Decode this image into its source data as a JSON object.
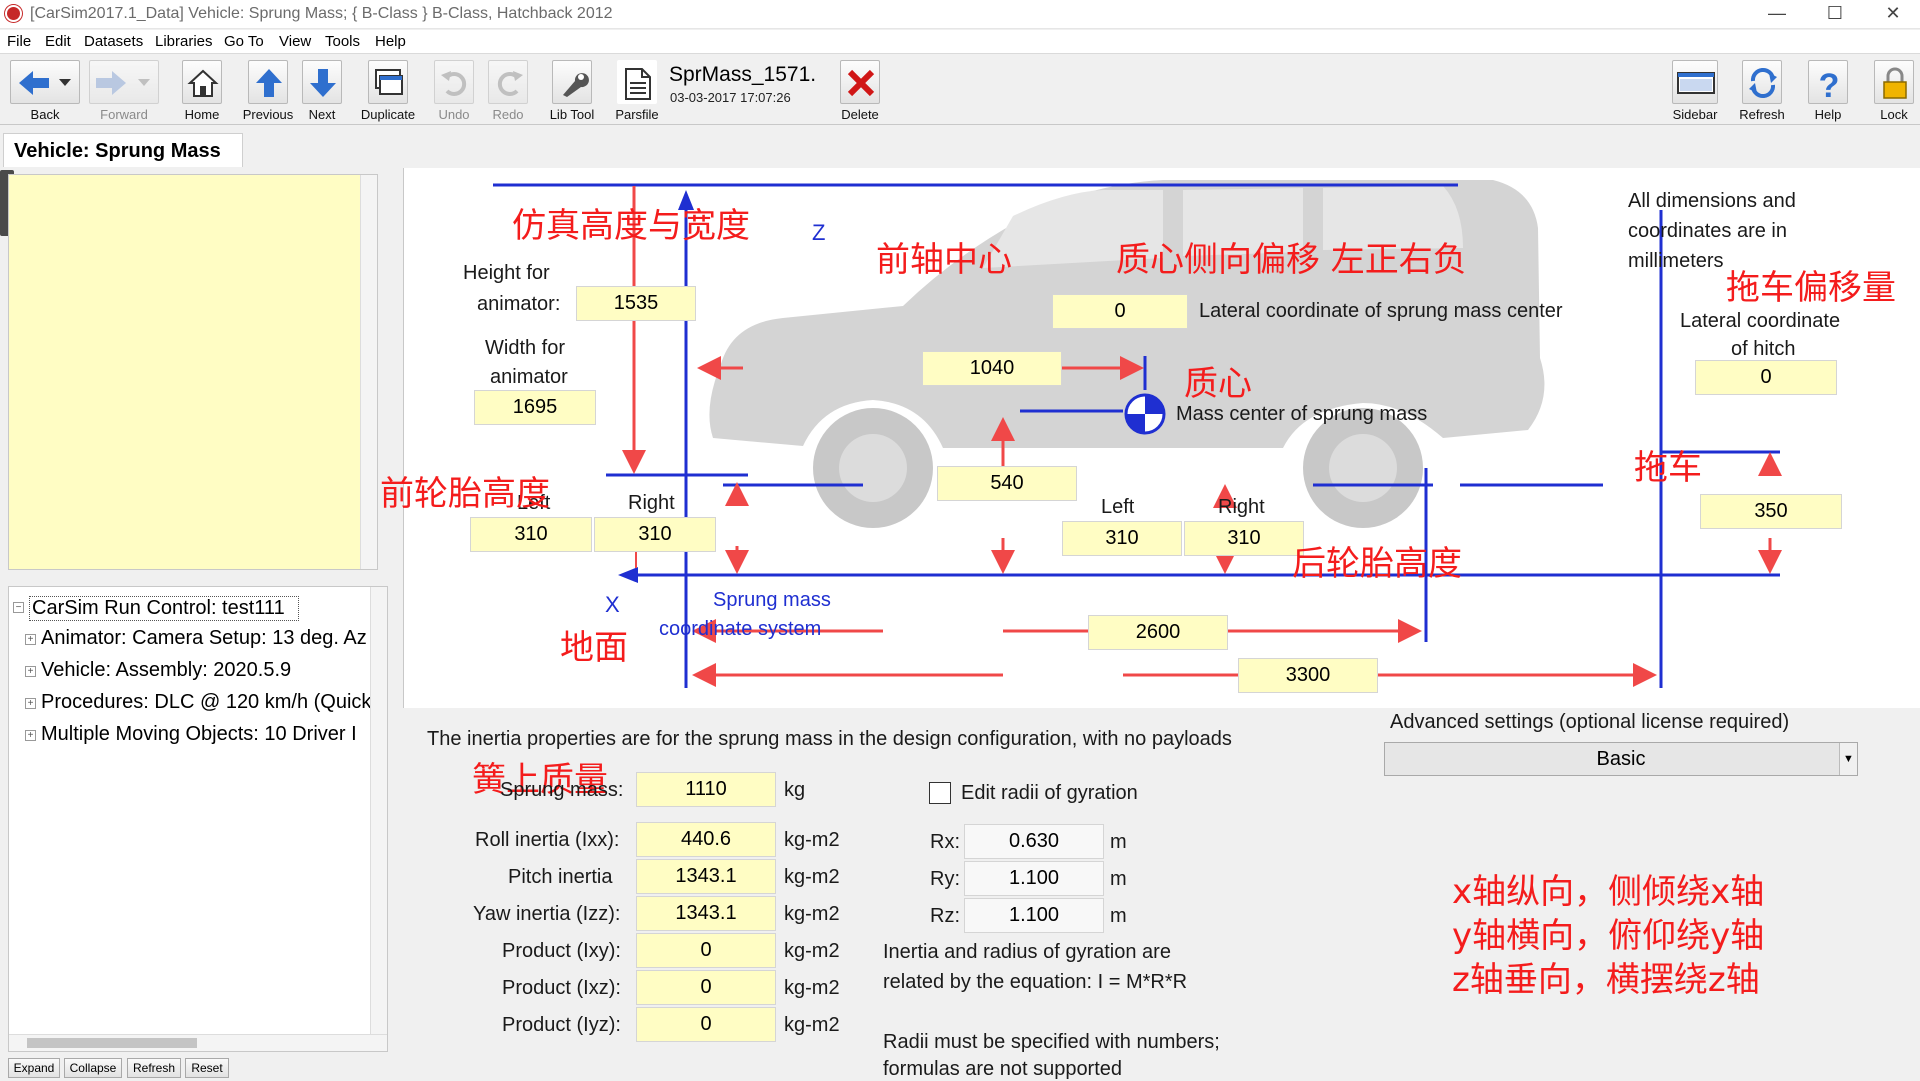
{
  "window": {
    "title": "[CarSim2017.1_Data] Vehicle: Sprung Mass; { B-Class } B-Class, Hatchback 2012"
  },
  "menu": [
    "File",
    "Edit",
    "Datasets",
    "Libraries",
    "Go To",
    "View",
    "Tools",
    "Help"
  ],
  "toolbar": {
    "back": "Back",
    "forward": "Forward",
    "home": "Home",
    "previous": "Previous",
    "next": "Next",
    "duplicate": "Duplicate",
    "undo": "Undo",
    "redo": "Redo",
    "libtool": "Lib Tool",
    "parsfile": "Parsfile",
    "dataset_name": "SprMass_1571.",
    "dataset_date": "03-03-2017 17:07:26",
    "delete": "Delete",
    "sidebar": "Sidebar",
    "refresh": "Refresh",
    "help": "Help",
    "lock": "Lock"
  },
  "tab": {
    "label": "Vehicle: Sprung Mass"
  },
  "tree": {
    "items": [
      {
        "label": "CarSim Run Control: test111",
        "toggle": "−"
      },
      {
        "label": "Animator: Camera Setup: 13 deg. Az",
        "toggle": "+"
      },
      {
        "label": "Vehicle: Assembly: 2020.5.9",
        "toggle": "+"
      },
      {
        "label": "Procedures: DLC @ 120 km/h (Quick",
        "toggle": "+"
      },
      {
        "label": "Multiple Moving Objects: 10 Driver I",
        "toggle": "+"
      }
    ],
    "buttons": {
      "expand": "Expand",
      "collapse": "Collapse",
      "refresh": "Refresh",
      "reset": "Reset"
    }
  },
  "diagram": {
    "z_axis": "Z",
    "x_axis": "X",
    "height_label_1": "Height for",
    "height_label_2": "animator:",
    "height_value": "1535",
    "width_label_1": "Width for",
    "width_label_2": "animator",
    "width_value": "1695",
    "lateral_cg_value": "0",
    "lateral_cg_label": "Lateral coordinate of sprung mass center",
    "dims_note_1": "All dimensions and",
    "dims_note_2": "coordinates are in",
    "dims_note_3": "millimeters",
    "hitch_label_1": "Lateral coordinate",
    "hitch_label_2": "of hitch",
    "hitch_value": "0",
    "cg_x_value": "1040",
    "cg_label": "Mass center of sprung mass",
    "cg_height_value": "540",
    "front_left_label": "Left",
    "front_right_label": "Right",
    "front_left_value": "310",
    "front_right_value": "310",
    "rear_left_label": "Left",
    "rear_right_label": "Right",
    "rear_left_value": "310",
    "rear_right_value": "310",
    "hitch_height_value": "350",
    "coord_sys_1": "Sprung mass",
    "coord_sys_2": "coordinate system",
    "wheelbase_value": "2600",
    "hitch_x_value": "3300"
  },
  "annotations": {
    "sim_size": "仿真高度与宽度",
    "front_axle": "前轴中心",
    "lateral_offset": "质心侧向偏移 左正右负",
    "trailer_offset": "拖车偏移量",
    "cg": "质心",
    "front_tire_height": "前轮胎高度",
    "trailer": "拖车",
    "rear_tire_height": "后轮胎高度",
    "ground": "地面",
    "sprung_mass": "簧上质量",
    "axis_x": "x轴纵向，侧倾绕x轴",
    "axis_y": "y轴横向，俯仰绕y轴",
    "axis_z": "z轴垂向，横摆绕z轴"
  },
  "inertia": {
    "intro": "The inertia properties are for the sprung mass in the design configuration, with no payloads",
    "sprung_mass_label": "Sprung mass:",
    "sprung_mass_value": "1110",
    "sprung_mass_unit": "kg",
    "roll_label": "Roll inertia (Ixx):",
    "roll_value": "440.6",
    "pitch_label": "Pitch inertia",
    "pitch_value": "1343.1",
    "yaw_label": "Yaw inertia (Izz):",
    "yaw_value": "1343.1",
    "ixy_label": "Product (Ixy):",
    "ixy_value": "0",
    "ixz_label": "Product (Ixz):",
    "ixz_value": "0",
    "iyz_label": "Product (Iyz):",
    "iyz_value": "0",
    "inertia_unit": "kg-m2",
    "edit_radii_label": "Edit radii of gyration",
    "rx_label": "Rx:",
    "rx_value": "0.630",
    "ry_label": "Ry:",
    "ry_value": "1.100",
    "rz_label": "Rz:",
    "rz_value": "1.100",
    "radii_unit": "m",
    "eq_note_1": "Inertia and radius of gyration are",
    "eq_note_2": "related by the equation: I = M*R*R",
    "num_note_1": "Radii must be specified with numbers;",
    "num_note_2": "formulas are not supported",
    "advanced_label": "Advanced settings (optional license required)",
    "advanced_value": "Basic"
  }
}
